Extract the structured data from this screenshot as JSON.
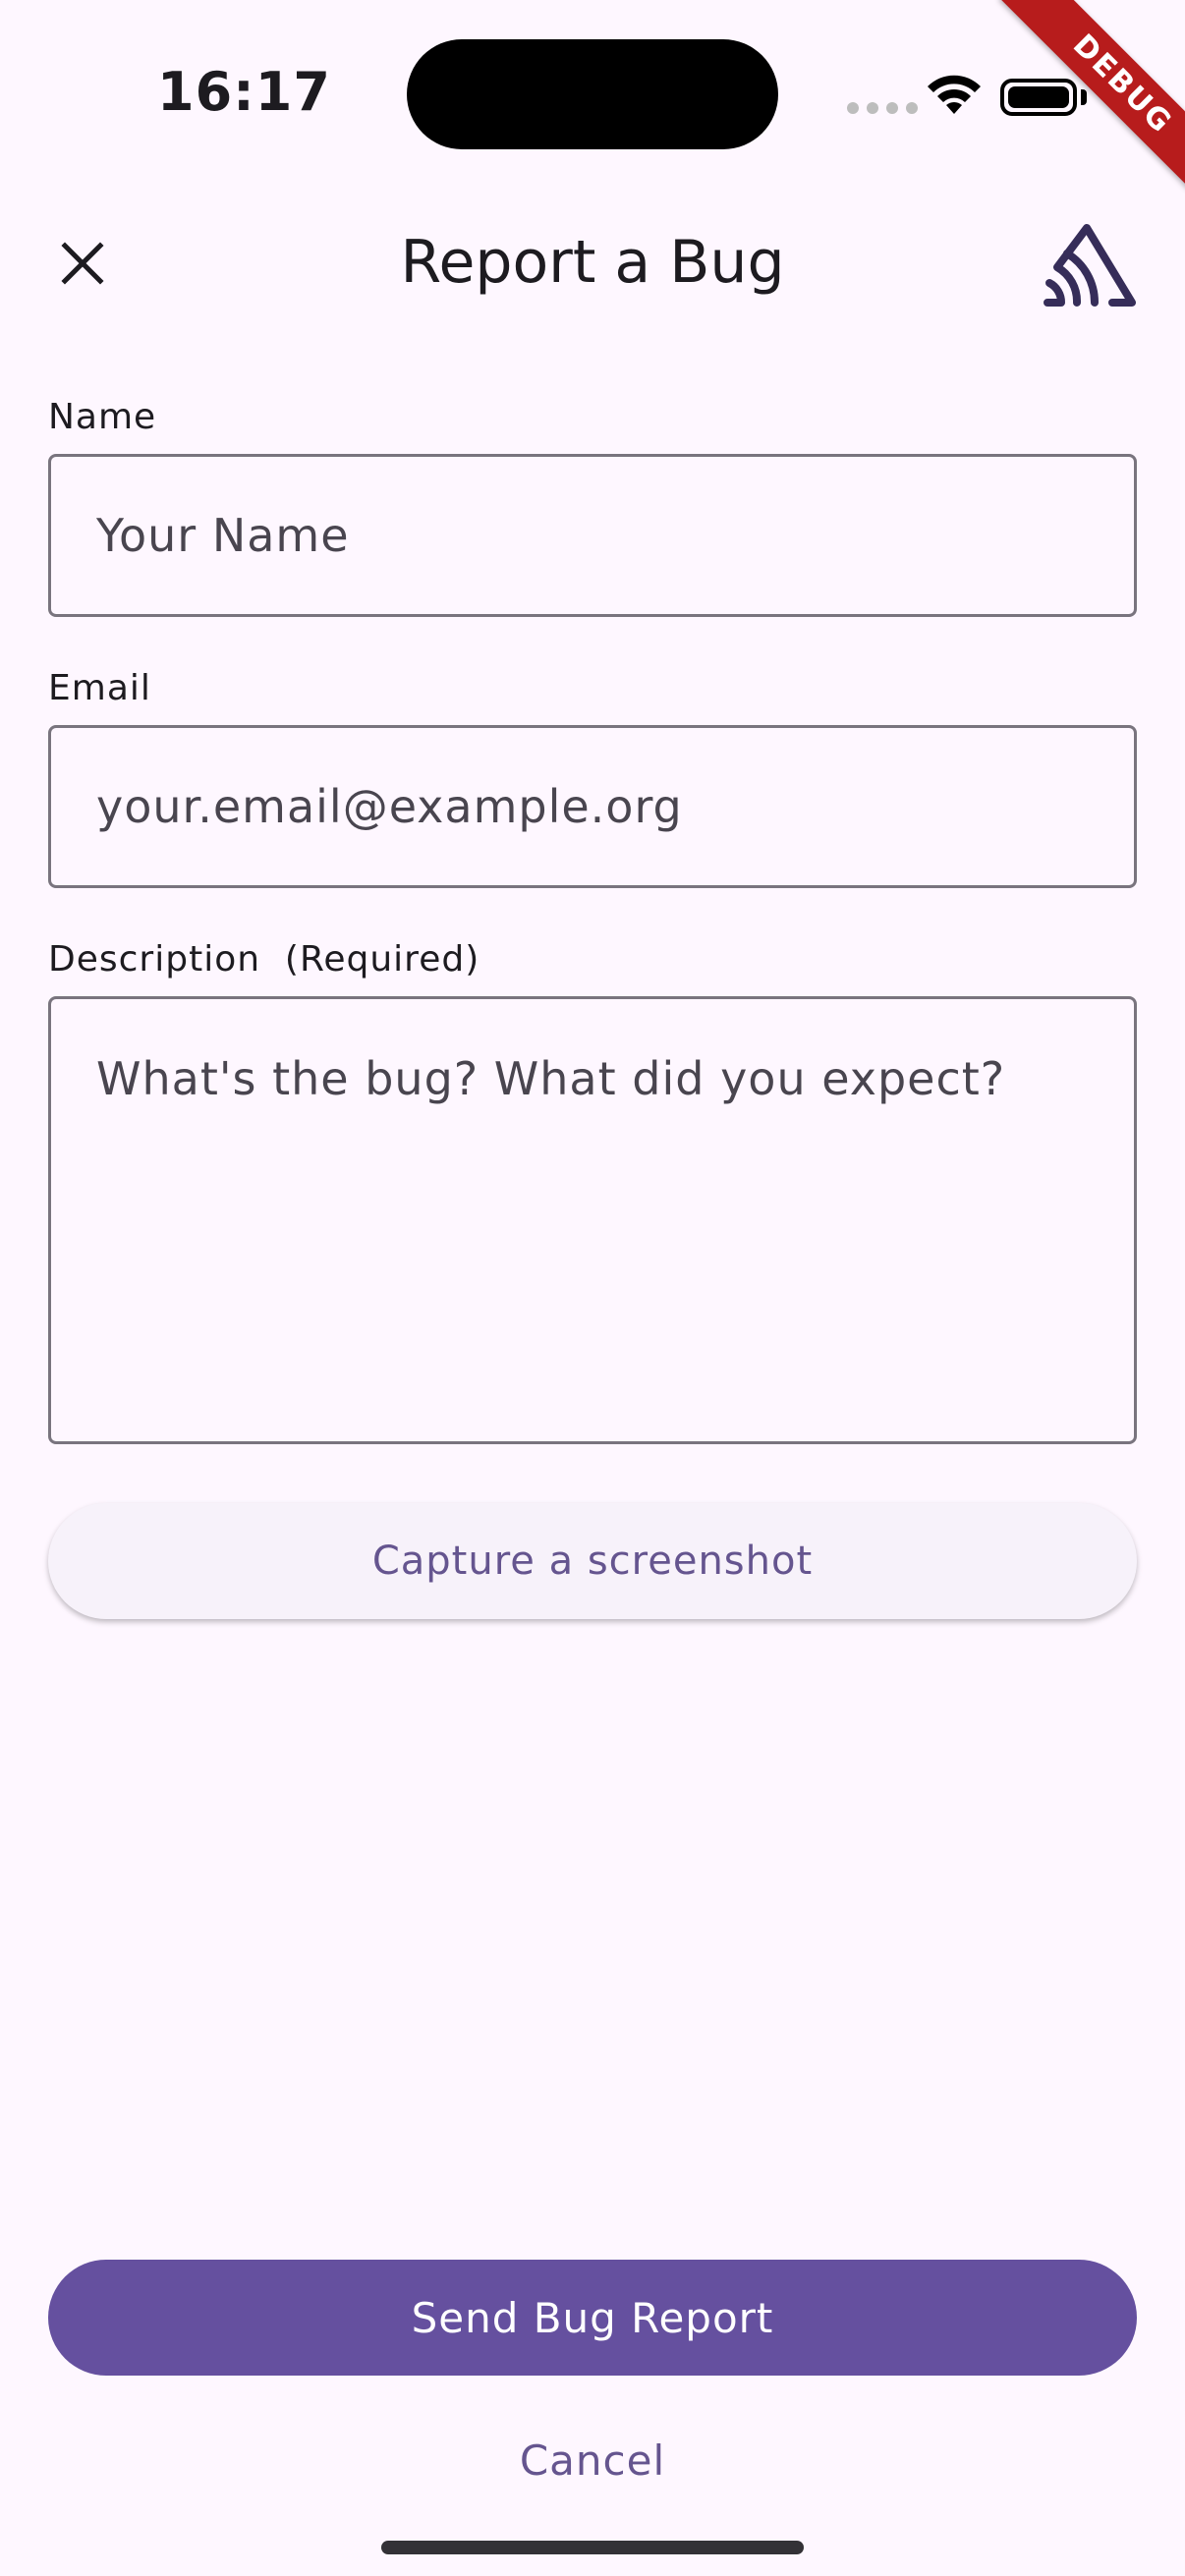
{
  "status_bar": {
    "time": "16:17"
  },
  "debug_banner": {
    "label": "DEBUG"
  },
  "header": {
    "title": "Report a Bug"
  },
  "form": {
    "name": {
      "label": "Name",
      "placeholder": "Your Name",
      "value": ""
    },
    "email": {
      "label": "Email",
      "placeholder": "your.email@example.org",
      "value": ""
    },
    "description": {
      "label": "Description  (Required)",
      "placeholder": "What's the bug? What did you expect?",
      "value": ""
    }
  },
  "actions": {
    "capture_label": "Capture a screenshot",
    "send_label": "Send Bug Report",
    "cancel_label": "Cancel"
  },
  "icons": {
    "close": "close-icon",
    "logo": "sentry-logo-icon",
    "wifi": "wifi-icon",
    "battery": "battery-icon"
  },
  "colors": {
    "background": "#FEF7FF",
    "primary": "#65509F",
    "accent_text": "#65558F",
    "outline": "#79747E",
    "debug_ribbon": "#B71C1C"
  }
}
